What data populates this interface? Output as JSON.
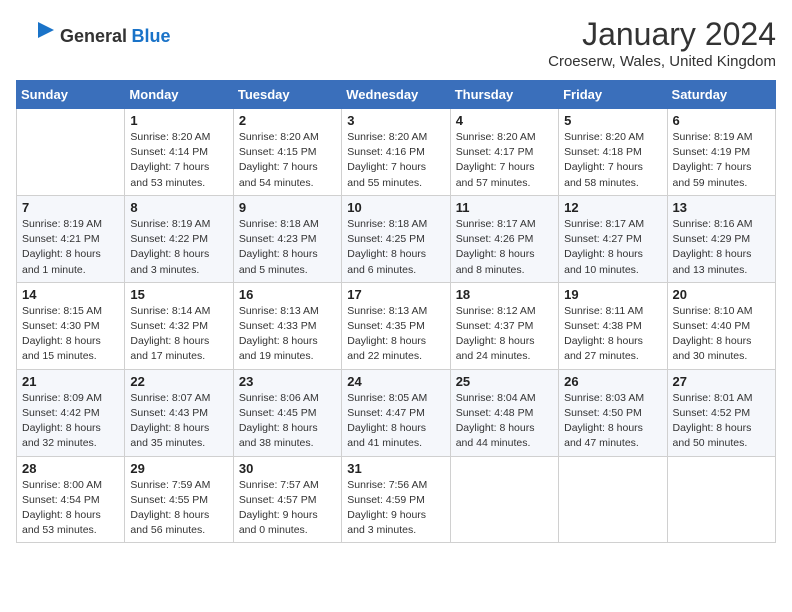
{
  "header": {
    "logo_general": "General",
    "logo_blue": "Blue",
    "month": "January 2024",
    "location": "Croeserw, Wales, United Kingdom"
  },
  "weekdays": [
    "Sunday",
    "Monday",
    "Tuesday",
    "Wednesday",
    "Thursday",
    "Friday",
    "Saturday"
  ],
  "weeks": [
    [
      {
        "day": "",
        "info": ""
      },
      {
        "day": "1",
        "info": "Sunrise: 8:20 AM\nSunset: 4:14 PM\nDaylight: 7 hours\nand 53 minutes."
      },
      {
        "day": "2",
        "info": "Sunrise: 8:20 AM\nSunset: 4:15 PM\nDaylight: 7 hours\nand 54 minutes."
      },
      {
        "day": "3",
        "info": "Sunrise: 8:20 AM\nSunset: 4:16 PM\nDaylight: 7 hours\nand 55 minutes."
      },
      {
        "day": "4",
        "info": "Sunrise: 8:20 AM\nSunset: 4:17 PM\nDaylight: 7 hours\nand 57 minutes."
      },
      {
        "day": "5",
        "info": "Sunrise: 8:20 AM\nSunset: 4:18 PM\nDaylight: 7 hours\nand 58 minutes."
      },
      {
        "day": "6",
        "info": "Sunrise: 8:19 AM\nSunset: 4:19 PM\nDaylight: 7 hours\nand 59 minutes."
      }
    ],
    [
      {
        "day": "7",
        "info": "Sunrise: 8:19 AM\nSunset: 4:21 PM\nDaylight: 8 hours\nand 1 minute."
      },
      {
        "day": "8",
        "info": "Sunrise: 8:19 AM\nSunset: 4:22 PM\nDaylight: 8 hours\nand 3 minutes."
      },
      {
        "day": "9",
        "info": "Sunrise: 8:18 AM\nSunset: 4:23 PM\nDaylight: 8 hours\nand 5 minutes."
      },
      {
        "day": "10",
        "info": "Sunrise: 8:18 AM\nSunset: 4:25 PM\nDaylight: 8 hours\nand 6 minutes."
      },
      {
        "day": "11",
        "info": "Sunrise: 8:17 AM\nSunset: 4:26 PM\nDaylight: 8 hours\nand 8 minutes."
      },
      {
        "day": "12",
        "info": "Sunrise: 8:17 AM\nSunset: 4:27 PM\nDaylight: 8 hours\nand 10 minutes."
      },
      {
        "day": "13",
        "info": "Sunrise: 8:16 AM\nSunset: 4:29 PM\nDaylight: 8 hours\nand 13 minutes."
      }
    ],
    [
      {
        "day": "14",
        "info": "Sunrise: 8:15 AM\nSunset: 4:30 PM\nDaylight: 8 hours\nand 15 minutes."
      },
      {
        "day": "15",
        "info": "Sunrise: 8:14 AM\nSunset: 4:32 PM\nDaylight: 8 hours\nand 17 minutes."
      },
      {
        "day": "16",
        "info": "Sunrise: 8:13 AM\nSunset: 4:33 PM\nDaylight: 8 hours\nand 19 minutes."
      },
      {
        "day": "17",
        "info": "Sunrise: 8:13 AM\nSunset: 4:35 PM\nDaylight: 8 hours\nand 22 minutes."
      },
      {
        "day": "18",
        "info": "Sunrise: 8:12 AM\nSunset: 4:37 PM\nDaylight: 8 hours\nand 24 minutes."
      },
      {
        "day": "19",
        "info": "Sunrise: 8:11 AM\nSunset: 4:38 PM\nDaylight: 8 hours\nand 27 minutes."
      },
      {
        "day": "20",
        "info": "Sunrise: 8:10 AM\nSunset: 4:40 PM\nDaylight: 8 hours\nand 30 minutes."
      }
    ],
    [
      {
        "day": "21",
        "info": "Sunrise: 8:09 AM\nSunset: 4:42 PM\nDaylight: 8 hours\nand 32 minutes."
      },
      {
        "day": "22",
        "info": "Sunrise: 8:07 AM\nSunset: 4:43 PM\nDaylight: 8 hours\nand 35 minutes."
      },
      {
        "day": "23",
        "info": "Sunrise: 8:06 AM\nSunset: 4:45 PM\nDaylight: 8 hours\nand 38 minutes."
      },
      {
        "day": "24",
        "info": "Sunrise: 8:05 AM\nSunset: 4:47 PM\nDaylight: 8 hours\nand 41 minutes."
      },
      {
        "day": "25",
        "info": "Sunrise: 8:04 AM\nSunset: 4:48 PM\nDaylight: 8 hours\nand 44 minutes."
      },
      {
        "day": "26",
        "info": "Sunrise: 8:03 AM\nSunset: 4:50 PM\nDaylight: 8 hours\nand 47 minutes."
      },
      {
        "day": "27",
        "info": "Sunrise: 8:01 AM\nSunset: 4:52 PM\nDaylight: 8 hours\nand 50 minutes."
      }
    ],
    [
      {
        "day": "28",
        "info": "Sunrise: 8:00 AM\nSunset: 4:54 PM\nDaylight: 8 hours\nand 53 minutes."
      },
      {
        "day": "29",
        "info": "Sunrise: 7:59 AM\nSunset: 4:55 PM\nDaylight: 8 hours\nand 56 minutes."
      },
      {
        "day": "30",
        "info": "Sunrise: 7:57 AM\nSunset: 4:57 PM\nDaylight: 9 hours\nand 0 minutes."
      },
      {
        "day": "31",
        "info": "Sunrise: 7:56 AM\nSunset: 4:59 PM\nDaylight: 9 hours\nand 3 minutes."
      },
      {
        "day": "",
        "info": ""
      },
      {
        "day": "",
        "info": ""
      },
      {
        "day": "",
        "info": ""
      }
    ]
  ]
}
